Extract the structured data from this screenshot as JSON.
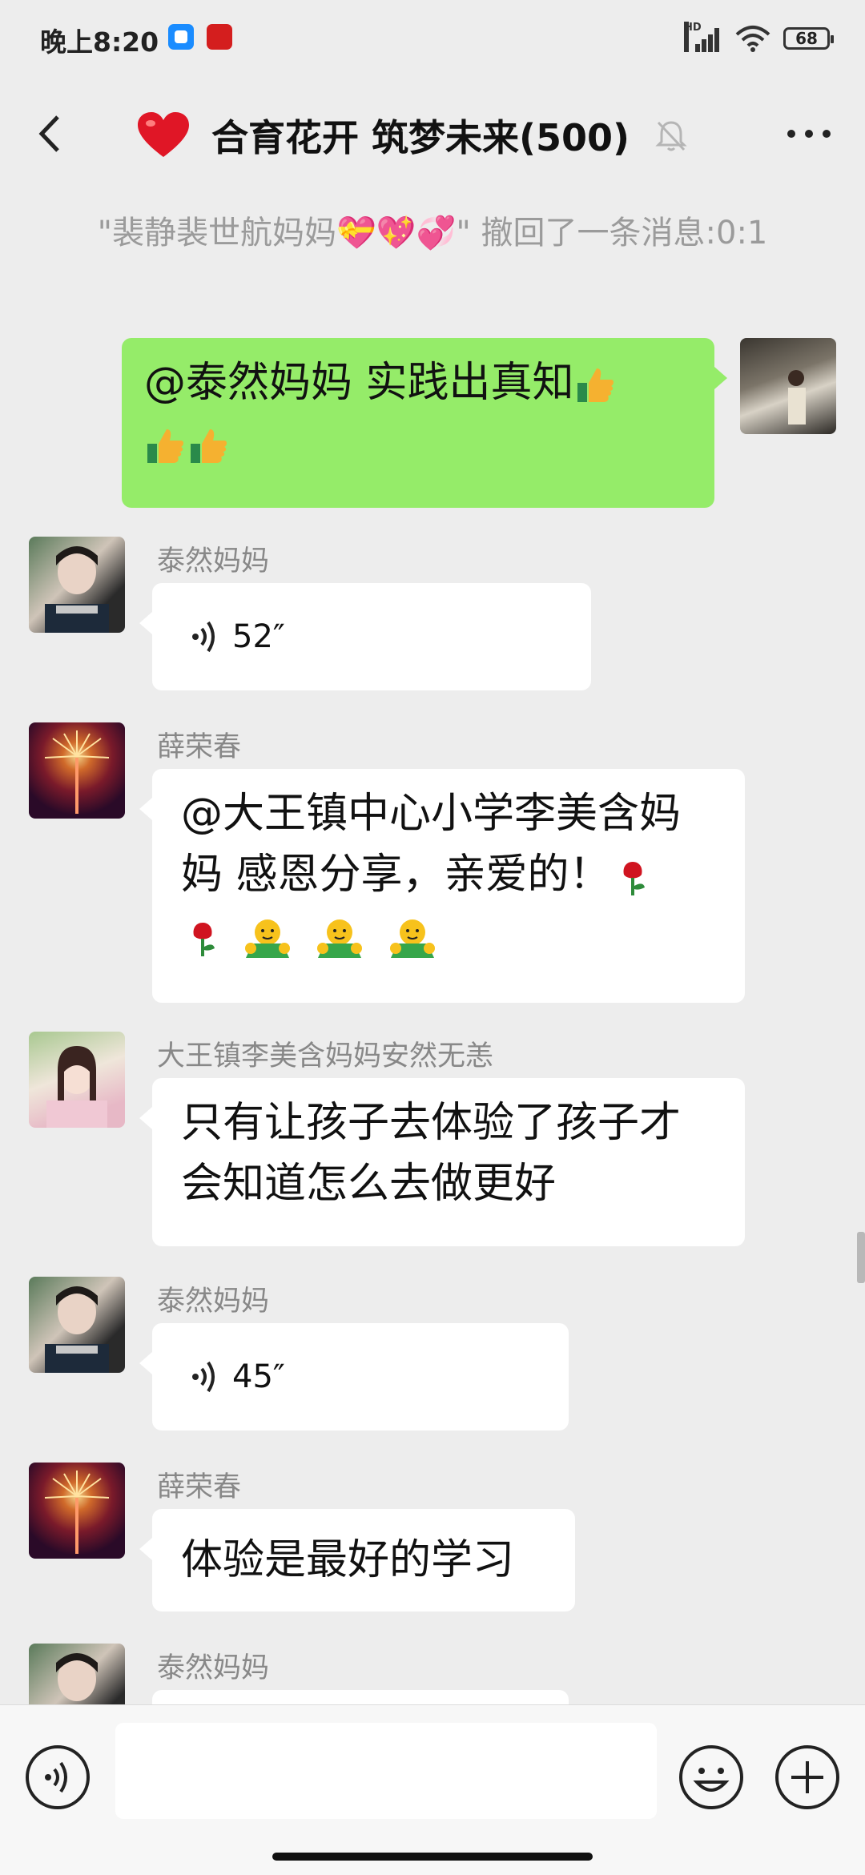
{
  "status_bar": {
    "time": "晚上8:20",
    "battery": "68",
    "network": "HD"
  },
  "header": {
    "title": "合育花开 筑梦未来(500)"
  },
  "system_notice": "\"裴静裴世航妈妈💝💖💞\" 撤回了一条消息:0:1",
  "messages": [
    {
      "type": "text",
      "side": "right",
      "mention": "@泰然妈妈",
      "text": "实践出真知"
    },
    {
      "type": "voice",
      "sender": "泰然妈妈",
      "duration": "52″"
    },
    {
      "type": "text",
      "sender": "薛荣春",
      "line1": "@大王镇中心小学李美含妈",
      "line2": "妈  感恩分享，亲爱的！"
    },
    {
      "type": "text",
      "sender": "大王镇李美含妈妈安然无恙",
      "line1": "只有让孩子去体验了孩子才",
      "line2": "会知道怎么去做更好"
    },
    {
      "type": "voice",
      "sender": "泰然妈妈",
      "duration": "45″"
    },
    {
      "type": "text",
      "sender": "薛荣春",
      "text": "体验是最好的学习"
    },
    {
      "type": "partial",
      "sender": "泰然妈妈"
    }
  ],
  "colors": {
    "background": "#ededed",
    "self_bubble": "#95ec69",
    "other_bubble": "#ffffff"
  }
}
